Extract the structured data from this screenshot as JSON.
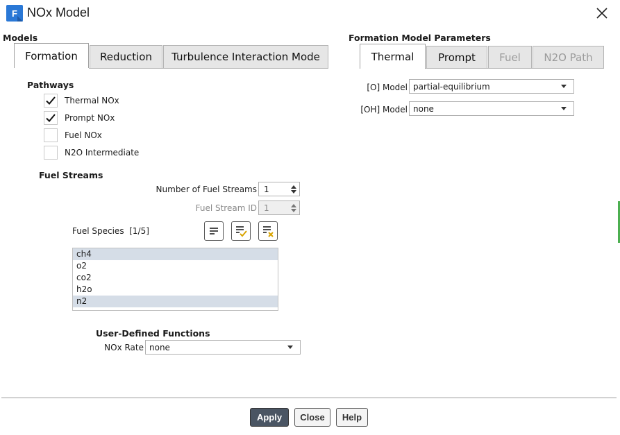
{
  "window": {
    "icon_letter": "F",
    "title": "NOx Model"
  },
  "models": {
    "heading": "Models",
    "tabs": [
      {
        "label": "Formation",
        "state": "active"
      },
      {
        "label": "Reduction",
        "state": "normal"
      },
      {
        "label": "Turbulence Interaction Mode",
        "state": "normal"
      }
    ]
  },
  "pathways": {
    "heading": "Pathways",
    "items": [
      {
        "label": "Thermal NOx",
        "checked": true
      },
      {
        "label": "Prompt NOx",
        "checked": true
      },
      {
        "label": "Fuel NOx",
        "checked": false
      },
      {
        "label": "N2O Intermediate",
        "checked": false
      }
    ]
  },
  "fuel_streams": {
    "heading": "Fuel Streams",
    "num_streams_label": "Number of Fuel Streams",
    "num_streams_value": "1",
    "stream_id_label": "Fuel Stream ID",
    "stream_id_value": "1",
    "species_label": "Fuel Species",
    "species_count": "[1/5]",
    "species": [
      {
        "name": "ch4",
        "selected": true
      },
      {
        "name": "o2",
        "selected": false
      },
      {
        "name": "co2",
        "selected": false
      },
      {
        "name": "h2o",
        "selected": false
      },
      {
        "name": "n2",
        "selected": true
      }
    ]
  },
  "udf": {
    "heading": "User-Defined Functions",
    "nox_rate_label": "NOx Rate",
    "nox_rate_value": "none"
  },
  "formation_params": {
    "heading": "Formation Model Parameters",
    "tabs": [
      {
        "label": "Thermal",
        "state": "active"
      },
      {
        "label": "Prompt",
        "state": "normal"
      },
      {
        "label": "Fuel",
        "state": "disabled"
      },
      {
        "label": "N2O Path",
        "state": "disabled"
      }
    ],
    "o_model_label": "[O] Model",
    "o_model_value": "partial-equilibrium",
    "oh_model_label": "[OH] Model",
    "oh_model_value": "none"
  },
  "buttons": {
    "apply": "Apply",
    "close": "Close",
    "help": "Help"
  },
  "colors": {
    "primary_button": "#4a5563",
    "selection": "#d5dde7",
    "app_icon": "#2a78d6"
  }
}
